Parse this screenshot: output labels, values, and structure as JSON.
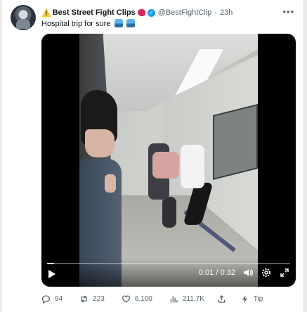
{
  "tweet": {
    "warning_emoji": "⚠️",
    "account_name": "Best Street Fight Clips",
    "handle": "@BestFightClip",
    "separator": "·",
    "time_ago": "23h",
    "more_label": "•••",
    "text": "Hospital trip for sure",
    "verified_color": "#1d9bf0"
  },
  "video": {
    "time_readout": "0:01 / 0:32",
    "progress_fraction": 0.03,
    "icons": [
      "play-icon",
      "volume-icon",
      "settings-gear-icon",
      "fullscreen-icon"
    ]
  },
  "actions": {
    "replies": "94",
    "reposts": "223",
    "likes": "6,100",
    "views": "211.7K",
    "tip_label": "Tip"
  }
}
